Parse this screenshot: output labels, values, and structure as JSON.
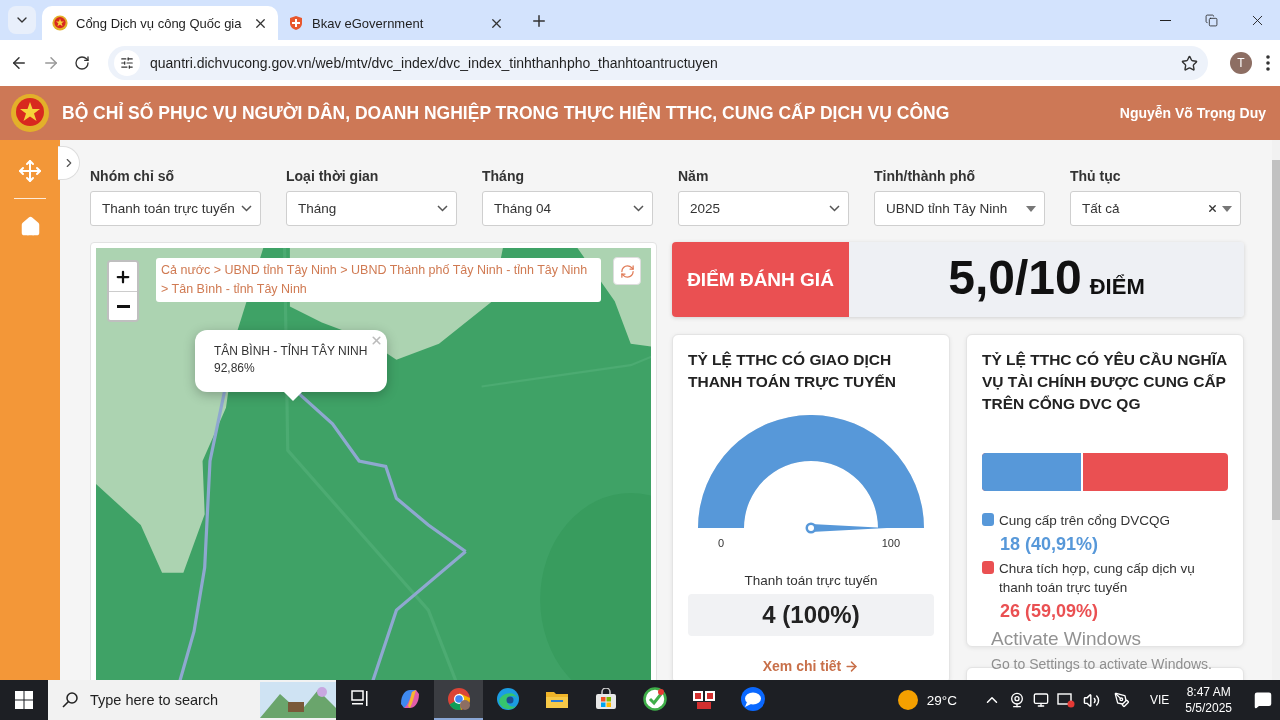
{
  "browser": {
    "tabs": [
      {
        "title": "Cổng Dịch vụ công Quốc gia",
        "selected": true
      },
      {
        "title": "Bkav eGovernment",
        "selected": false
      }
    ],
    "url": "quantri.dichvucong.gov.vn/web/mtv/dvc_index/dvc_index_tinhthanhpho_thanhtoantructuyen",
    "profile_initial": "T"
  },
  "header": {
    "title": "BỘ CHỈ SỐ PHỤC VỤ NGƯỜI DÂN, DOANH NGHIỆP TRONG THỰC HIỆN TTHC, CUNG CẤP DỊCH VỤ CÔNG",
    "user": "Nguyễn Võ Trọng Duy"
  },
  "filters": [
    {
      "label": "Nhóm chỉ số",
      "value": "Thanh toán trực tuyến",
      "kind": "chevron"
    },
    {
      "label": "Loại thời gian",
      "value": "Tháng",
      "kind": "chevron"
    },
    {
      "label": "Tháng",
      "value": "Tháng 04",
      "kind": "chevron"
    },
    {
      "label": "Năm",
      "value": "2025",
      "kind": "chevron"
    },
    {
      "label": "Tỉnh/thành phố",
      "value": "UBND tỉnh Tây Ninh",
      "kind": "caret"
    },
    {
      "label": "Thủ tục",
      "value": "Tất cả",
      "kind": "caret-clear"
    }
  ],
  "map": {
    "breadcrumb": "Cả nước > UBND tỉnh Tây Ninh > UBND Thành phố Tây Ninh - tỉnh Tây Ninh > Tân Bình - tỉnh Tây Ninh",
    "popup": {
      "title": "TÂN BÌNH - TỈNH TÂY NINH",
      "value": "92,86%"
    }
  },
  "score": {
    "label": "ĐIỂM ĐÁNH GIÁ",
    "value": "5,0/10",
    "unit": "ĐIỂM"
  },
  "cards": [
    {
      "kind": "gauge",
      "title": "TỶ LỆ TTHC CÓ GIAO DỊCH THANH TOÁN TRỰC TUYẾN",
      "level": 1,
      "min": "0",
      "max": "100",
      "caption": "Thanh toán trực tuyến",
      "value": "4 (100%)",
      "link": "Xem chi tiết"
    },
    {
      "kind": "stacked-bar",
      "title": "TỶ LỆ TTHC CÓ YÊU CẦU NGHĨA VỤ TÀI CHÍNH ĐƯỢC CUNG CẤP TRÊN CỔNG DVC QG",
      "segments": [
        {
          "label": "Cung cấp trên cổng DVCQG",
          "value": "18 (40,91%)",
          "color": "#5798d9",
          "level": 0.4091
        },
        {
          "label": "Chưa tích hợp, cung cấp dịch vụ thanh toán trực tuyến",
          "value": "26 (59,09%)",
          "color": "#ea5052"
        }
      ]
    }
  ],
  "activation": {
    "title": "Activate Windows",
    "hint": "Go to Settings to activate Windows."
  },
  "taskbar": {
    "search_placeholder": "Type here to search",
    "apps": [
      {
        "kind": "task-view",
        "selected": false
      },
      {
        "kind": "copilot",
        "selected": false
      },
      {
        "kind": "chrome",
        "selected": true
      },
      {
        "kind": "edge",
        "selected": false
      },
      {
        "kind": "explorer",
        "selected": false
      },
      {
        "kind": "store",
        "selected": false
      },
      {
        "kind": "green",
        "selected": false
      },
      {
        "kind": "red",
        "selected": false
      },
      {
        "kind": "zalo",
        "selected": false
      }
    ],
    "temperature": "29°C",
    "language": "VIE",
    "time": "8:47 AM",
    "date": "5/5/2025"
  }
}
